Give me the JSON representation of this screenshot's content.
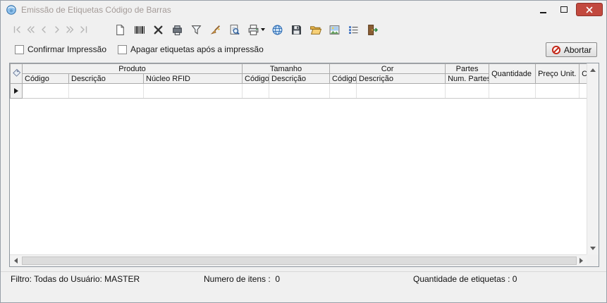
{
  "window": {
    "title": "Emissão de Etiquetas Código de Barras"
  },
  "colors": {
    "close_button": "#c2493e",
    "abort_icon": "#c42b1c"
  },
  "toolbar": {
    "nav_icons": [
      "first-record",
      "prior-fast",
      "prior-record",
      "next-record",
      "next-fast",
      "last-record"
    ],
    "action_icons": [
      "new-document",
      "barcode",
      "delete",
      "barcode-printer",
      "filter",
      "clear",
      "print-preview",
      "print",
      "web",
      "save",
      "open-folder",
      "image",
      "list",
      "exit"
    ]
  },
  "options": {
    "confirm_print_label": "Confirmar Impressão",
    "delete_after_label": "Apagar etiquetas após a impressão",
    "abort_button_label": "Abortar"
  },
  "grid": {
    "bands": [
      "Produto",
      "Tamanho",
      "Cor",
      "Partes"
    ],
    "sub_columns": [
      "Código",
      "Descrição",
      "Núcleo RFID",
      "Código",
      "Descrição",
      "Código",
      "Descrição",
      "Num. Partes"
    ],
    "span_columns": [
      "Quantidade",
      "Preço Unit.",
      "C"
    ],
    "row_count": 1
  },
  "statusbar": {
    "filter": "Filtro: Todas do Usuário: MASTER",
    "item_count": "Numero de itens :  0",
    "label_count": "Quantidade de etiquetas : 0"
  }
}
